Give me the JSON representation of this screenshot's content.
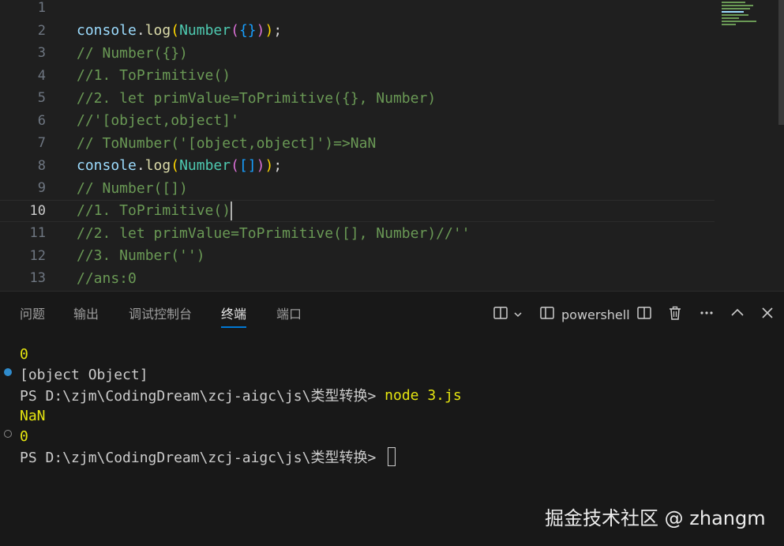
{
  "editor": {
    "lines": [
      {
        "num": "1"
      },
      {
        "num": "2"
      },
      {
        "num": "3",
        "text": "// Number({})"
      },
      {
        "num": "4",
        "text": "//1. ToPrimitive()"
      },
      {
        "num": "5",
        "text": "//2. let primValue=ToPrimitive({}, Number)"
      },
      {
        "num": "6",
        "text": "//'[object,object]'"
      },
      {
        "num": "7",
        "text": "// ToNumber('[object,object]')=>NaN"
      },
      {
        "num": "8"
      },
      {
        "num": "9",
        "text": "// Number([])"
      },
      {
        "num": "10",
        "text": "//1. ToPrimitive()"
      },
      {
        "num": "11",
        "text": "//2. let primValue=ToPrimitive([], Number)//''"
      },
      {
        "num": "12",
        "text": "//3. Number('')"
      },
      {
        "num": "13",
        "text": "//ans:0"
      }
    ],
    "line2": {
      "obj": "console",
      "dot": ".",
      "method": "log",
      "p1": "(",
      "cls": "Number",
      "p2": "(",
      "arg": "{}",
      "p3": ")",
      "p4": ")",
      "semi": ";"
    },
    "line8": {
      "obj": "console",
      "dot": ".",
      "method": "log",
      "p1": "(",
      "cls": "Number",
      "p2": "(",
      "arg": "[]",
      "p3": ")",
      "p4": ")",
      "semi": ";"
    }
  },
  "panel": {
    "tabs": [
      "问题",
      "输出",
      "调试控制台",
      "终端",
      "端口"
    ],
    "active_tab": "终端",
    "shell_label": "powershell",
    "icons": [
      "split-layout-icon",
      "chevron-down-icon",
      "terminal-icon",
      "split-terminal-icon",
      "trash-icon",
      "more-icon",
      "chevron-up-icon",
      "close-icon"
    ]
  },
  "terminal": {
    "lines": [
      {
        "text": "0",
        "kind": "output"
      },
      {
        "text": "[object Object]",
        "kind": "output"
      },
      {
        "prompt": "PS D:\\zjm\\CodingDream\\zcj-aigc\\js\\类型转换> ",
        "cmd": "node 3.js"
      },
      {
        "text": "NaN",
        "kind": "output"
      },
      {
        "text": "0",
        "kind": "output"
      },
      {
        "prompt": "PS D:\\zjm\\CodingDream\\zcj-aigc\\js\\类型转换> ",
        "cmd": ""
      }
    ]
  },
  "watermark": "掘金技术社区 @ zhangm",
  "colors": {
    "accent": "#0078d4",
    "comment": "#6a9955",
    "console_var": "#9cdcfe",
    "terminal_yellow": "#e5e510"
  }
}
